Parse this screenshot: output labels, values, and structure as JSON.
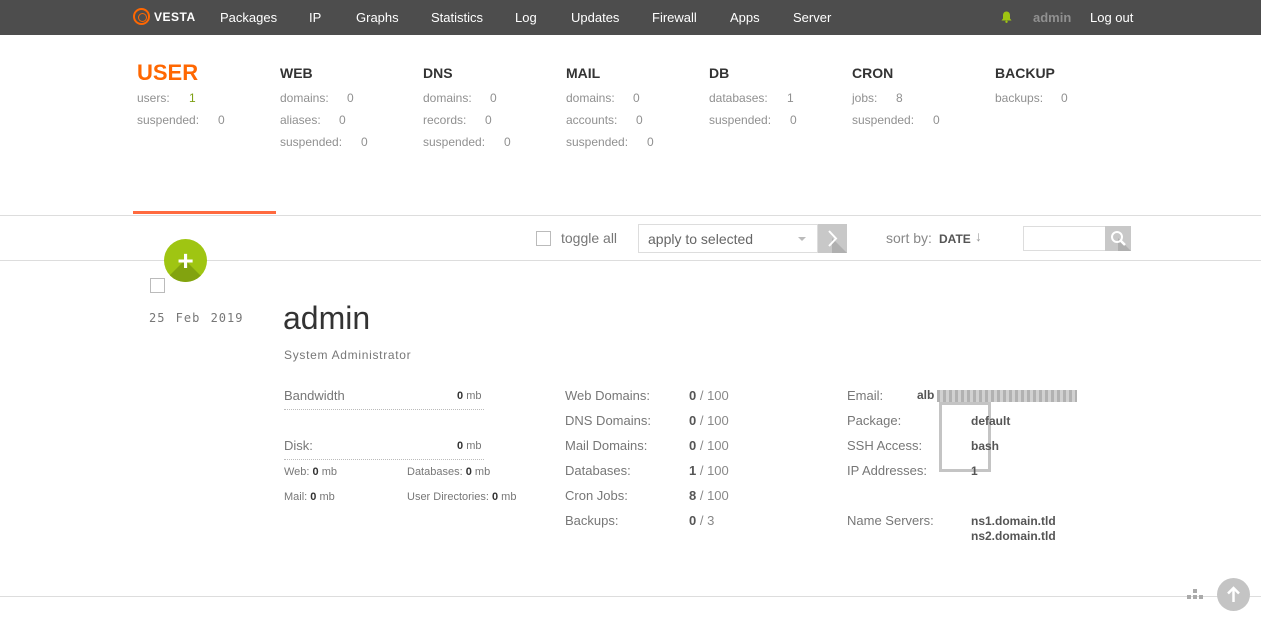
{
  "nav": {
    "logo": "VESTA",
    "items": [
      "Packages",
      "IP",
      "Graphs",
      "Statistics",
      "Log",
      "Updates",
      "Firewall",
      "Apps",
      "Server"
    ],
    "user": "admin",
    "logout": "Log out"
  },
  "stats": {
    "user": {
      "title": "USER",
      "rows": [
        {
          "label": "users:",
          "value": "1"
        },
        {
          "label": "suspended:",
          "value": "0"
        }
      ]
    },
    "web": {
      "title": "WEB",
      "rows": [
        {
          "label": "domains:",
          "value": "0"
        },
        {
          "label": "aliases:",
          "value": "0"
        },
        {
          "label": "suspended:",
          "value": "0"
        }
      ]
    },
    "dns": {
      "title": "DNS",
      "rows": [
        {
          "label": "domains:",
          "value": "0"
        },
        {
          "label": "records:",
          "value": "0"
        },
        {
          "label": "suspended:",
          "value": "0"
        }
      ]
    },
    "mail": {
      "title": "MAIL",
      "rows": [
        {
          "label": "domains:",
          "value": "0"
        },
        {
          "label": "accounts:",
          "value": "0"
        },
        {
          "label": "suspended:",
          "value": "0"
        }
      ]
    },
    "db": {
      "title": "DB",
      "rows": [
        {
          "label": "databases:",
          "value": "1"
        },
        {
          "label": "suspended:",
          "value": "0"
        }
      ]
    },
    "cron": {
      "title": "CRON",
      "rows": [
        {
          "label": "jobs:",
          "value": "8"
        },
        {
          "label": "suspended:",
          "value": "0"
        }
      ]
    },
    "backup": {
      "title": "BACKUP",
      "rows": [
        {
          "label": "backups:",
          "value": "0"
        }
      ]
    }
  },
  "toolbar": {
    "toggle_all": "toggle all",
    "apply_placeholder": "apply to selected",
    "sort_label": "sort by:",
    "sort_value": "DATE",
    "sort_arrow": "↓",
    "add_icon": "+"
  },
  "record": {
    "date": "25 Feb 2019",
    "name": "admin",
    "role": "System Administrator",
    "bandwidth": {
      "label": "Bandwidth",
      "value": "0",
      "unit": "mb"
    },
    "disk": {
      "label": "Disk:",
      "value": "0",
      "unit": "mb"
    },
    "sub_usage": {
      "web": {
        "label": "Web:",
        "value": "0",
        "unit": "mb"
      },
      "databases": {
        "label": "Databases:",
        "value": "0",
        "unit": "mb"
      },
      "mail": {
        "label": "Mail:",
        "value": "0",
        "unit": "mb"
      },
      "user_dirs": {
        "label": "User Directories:",
        "value": "0",
        "unit": "mb"
      }
    },
    "limits": [
      {
        "label": "Web Domains:",
        "used": "0",
        "max": "100"
      },
      {
        "label": "DNS Domains:",
        "used": "0",
        "max": "100"
      },
      {
        "label": "Mail Domains:",
        "used": "0",
        "max": "100"
      },
      {
        "label": "Databases:",
        "used": "1",
        "max": "100"
      },
      {
        "label": "Cron Jobs:",
        "used": "8",
        "max": "100"
      },
      {
        "label": "Backups:",
        "used": "0",
        "max": "3"
      }
    ],
    "info": {
      "email_label": "Email:",
      "email_value": "alb",
      "package_label": "Package:",
      "package_value": "default",
      "ssh_label": "SSH Access:",
      "ssh_value": "bash",
      "ip_label": "IP Addresses:",
      "ip_value": "1",
      "ns_label": "Name Servers:",
      "ns1": "ns1.domain.tld",
      "ns2": "ns2.domain.tld"
    }
  },
  "colors": {
    "accent": "#ff6701",
    "green": "#9fc512",
    "topbar": "#4d4d4d"
  }
}
